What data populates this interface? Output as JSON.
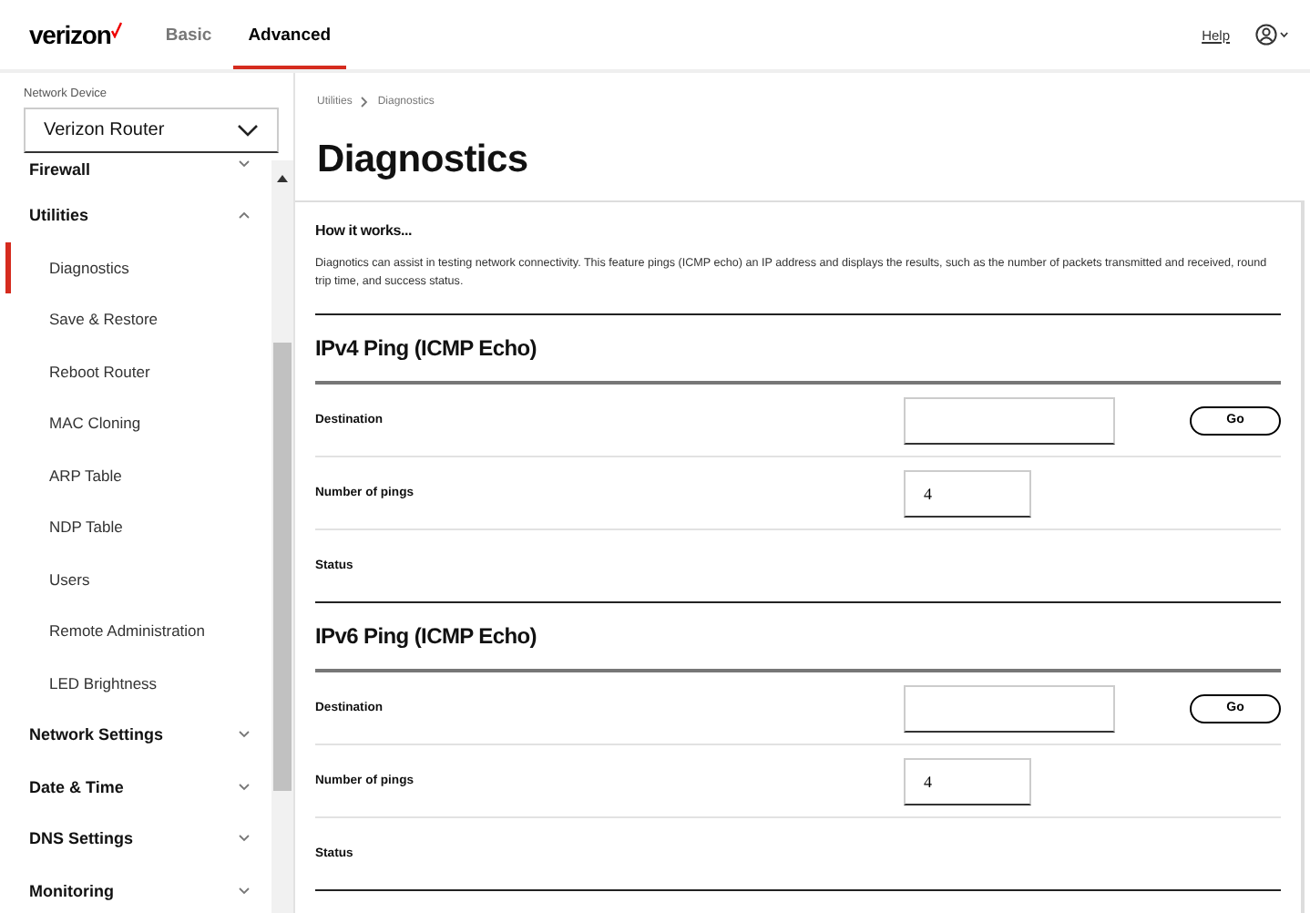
{
  "header": {
    "logo": "verizon",
    "tabs": [
      {
        "label": "Basic",
        "selected": false
      },
      {
        "label": "Advanced",
        "selected": true
      }
    ],
    "help_link": "Help"
  },
  "sidebar": {
    "device_label": "Network Device",
    "device_select": "Verizon Router",
    "groups": [
      {
        "label": "Firewall",
        "expanded": false
      },
      {
        "label": "Utilities",
        "expanded": true,
        "children": [
          {
            "label": "Diagnostics",
            "selected": true
          },
          {
            "label": "Save & Restore",
            "selected": false
          },
          {
            "label": "Reboot Router",
            "selected": false
          },
          {
            "label": "MAC Cloning",
            "selected": false
          },
          {
            "label": "ARP Table",
            "selected": false
          },
          {
            "label": "NDP Table",
            "selected": false
          },
          {
            "label": "Users",
            "selected": false
          },
          {
            "label": "Remote Administration",
            "selected": false
          },
          {
            "label": "LED Brightness",
            "selected": false
          }
        ]
      },
      {
        "label": "Network Settings",
        "expanded": false
      },
      {
        "label": "Date & Time",
        "expanded": false
      },
      {
        "label": "DNS Settings",
        "expanded": false
      },
      {
        "label": "Monitoring",
        "expanded": false
      }
    ]
  },
  "breadcrumb": [
    "Utilities",
    "Diagnostics"
  ],
  "title": "Diagnostics",
  "intro": {
    "heading": "How it works...",
    "text": "Diagnotics can assist in testing network connectivity. This feature pings (ICMP echo) an IP address and displays the results, such as the number of packets transmitted and received, round trip time, and success status."
  },
  "sections": [
    {
      "heading": "IPv4 Ping (ICMP Echo)",
      "rows": [
        {
          "kind": "address",
          "label": "Destination",
          "button": "Go"
        },
        {
          "kind": "count",
          "label": "Number of pings",
          "value": "4"
        },
        {
          "kind": "status",
          "label": "Status"
        }
      ]
    },
    {
      "heading": "IPv6 Ping (ICMP Echo)",
      "rows": [
        {
          "kind": "address",
          "label": "Destination",
          "button": "Go"
        },
        {
          "kind": "count",
          "label": "Number of pings",
          "value": "4"
        },
        {
          "kind": "status",
          "label": "Status"
        }
      ]
    }
  ]
}
